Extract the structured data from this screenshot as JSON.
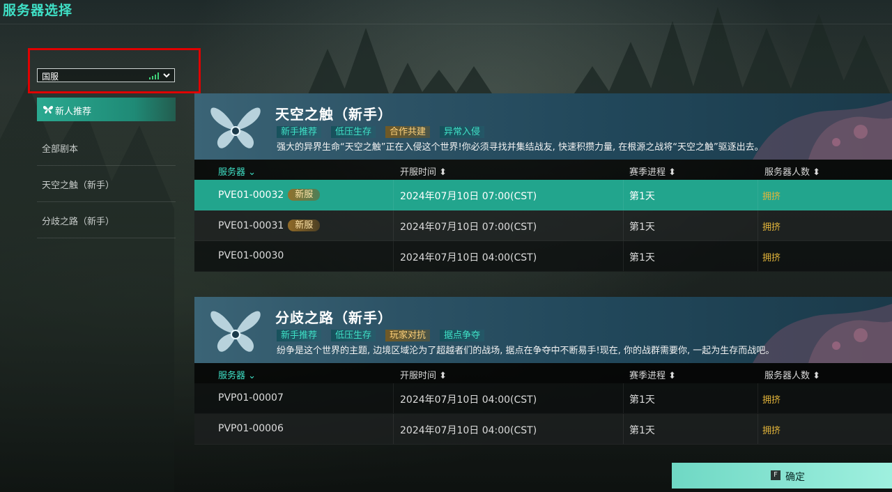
{
  "app_title": "服务器选择",
  "region": {
    "selected": "国服"
  },
  "sidebar": {
    "items": [
      {
        "label": "新人推荐",
        "active": true
      },
      {
        "label": "全部剧本"
      },
      {
        "label": "天空之触（新手）"
      },
      {
        "label": "分歧之路（新手）"
      }
    ]
  },
  "table_headers": {
    "server": "服务器",
    "open_time": "开服时间",
    "season": "赛季进程",
    "population": "服务器人数"
  },
  "sections": [
    {
      "name": "天空之触（新手）",
      "tags": [
        {
          "label": "新手推荐",
          "color": "teal"
        },
        {
          "label": "低压生存",
          "color": "teal"
        },
        {
          "label": "合作共建",
          "color": "gold"
        },
        {
          "label": "异常入侵",
          "color": "teal"
        }
      ],
      "description": "强大的异界生命“天空之触”正在入侵这个世界!你必须寻找并集结战友, 快速积攒力量, 在根源之战将“天空之触”驱逐出去。",
      "rows": [
        {
          "server": "PVE01-00032",
          "badge": "新服",
          "open_time": "2024年07月10日 07:00(CST)",
          "season": "第1天",
          "population": "拥挤",
          "selected": true
        },
        {
          "server": "PVE01-00031",
          "badge": "新服",
          "open_time": "2024年07月10日 07:00(CST)",
          "season": "第1天",
          "population": "拥挤"
        },
        {
          "server": "PVE01-00030",
          "badge": "",
          "open_time": "2024年07月10日 04:00(CST)",
          "season": "第1天",
          "population": "拥挤"
        }
      ]
    },
    {
      "name": "分歧之路（新手）",
      "tags": [
        {
          "label": "新手推荐",
          "color": "teal"
        },
        {
          "label": "低压生存",
          "color": "teal"
        },
        {
          "label": "玩家对抗",
          "color": "gold"
        },
        {
          "label": "据点争夺",
          "color": "teal"
        }
      ],
      "description": "纷争是这个世界的主题, 边境区域沦为了超越者们的战场, 据点在争夺中不断易手!现在, 你的战群需要你, 一起为生存而战吧。",
      "rows": [
        {
          "server": "PVP01-00007",
          "badge": "",
          "open_time": "2024年07月10日 04:00(CST)",
          "season": "第1天",
          "population": "拥挤"
        },
        {
          "server": "PVP01-00006",
          "badge": "",
          "open_time": "2024年07月10日 04:00(CST)",
          "season": "第1天",
          "population": "拥挤"
        }
      ]
    }
  ],
  "confirm": {
    "key": "F",
    "label": "确定"
  },
  "colors": {
    "accent": "#3fe0c6",
    "selected_row": "#22a58d",
    "population": "#e2b43a",
    "highlight": "#e00000"
  }
}
